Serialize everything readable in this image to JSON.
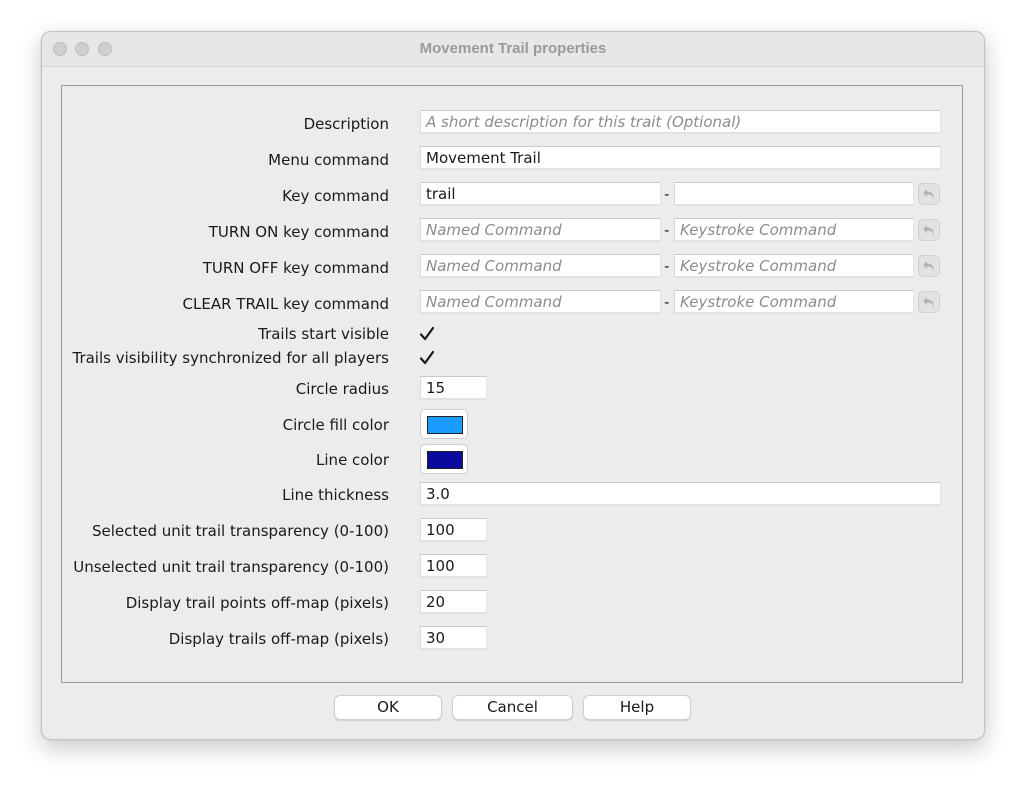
{
  "window": {
    "title": "Movement Trail properties"
  },
  "fields": {
    "description": {
      "label": "Description",
      "value": "",
      "placeholder": "A short description for this trait (Optional)"
    },
    "menu_command": {
      "label": "Menu command",
      "value": "Movement Trail"
    },
    "key_command": {
      "label": "Key command",
      "named_value": "trail",
      "keystroke_value": ""
    },
    "turn_on": {
      "label": "TURN ON key command",
      "named_placeholder": "Named Command",
      "keystroke_placeholder": "Keystroke Command"
    },
    "turn_off": {
      "label": "TURN OFF key command",
      "named_placeholder": "Named Command",
      "keystroke_placeholder": "Keystroke Command"
    },
    "clear_trail": {
      "label": "CLEAR TRAIL key command",
      "named_placeholder": "Named Command",
      "keystroke_placeholder": "Keystroke Command"
    },
    "trails_start_visible": {
      "label": "Trails start visible",
      "checked": true
    },
    "trails_sync": {
      "label": "Trails visibility synchronized for all players",
      "checked": true
    },
    "circle_radius": {
      "label": "Circle radius",
      "value": "15"
    },
    "circle_fill_color": {
      "label": "Circle fill color",
      "color": "#1a9bff"
    },
    "line_color": {
      "label": "Line color",
      "color": "#0a0a9c"
    },
    "line_thickness": {
      "label": "Line thickness",
      "value": "3.0"
    },
    "selected_transparency": {
      "label": "Selected unit trail transparency (0-100)",
      "value": "100"
    },
    "unselected_transparency": {
      "label": "Unselected unit trail transparency (0-100)",
      "value": "100"
    },
    "trail_points_offmap": {
      "label": "Display trail points off-map (pixels)",
      "value": "20"
    },
    "trails_offmap": {
      "label": "Display trails off-map (pixels)",
      "value": "30"
    }
  },
  "separator": "-",
  "buttons": {
    "ok": "OK",
    "cancel": "Cancel",
    "help": "Help"
  }
}
